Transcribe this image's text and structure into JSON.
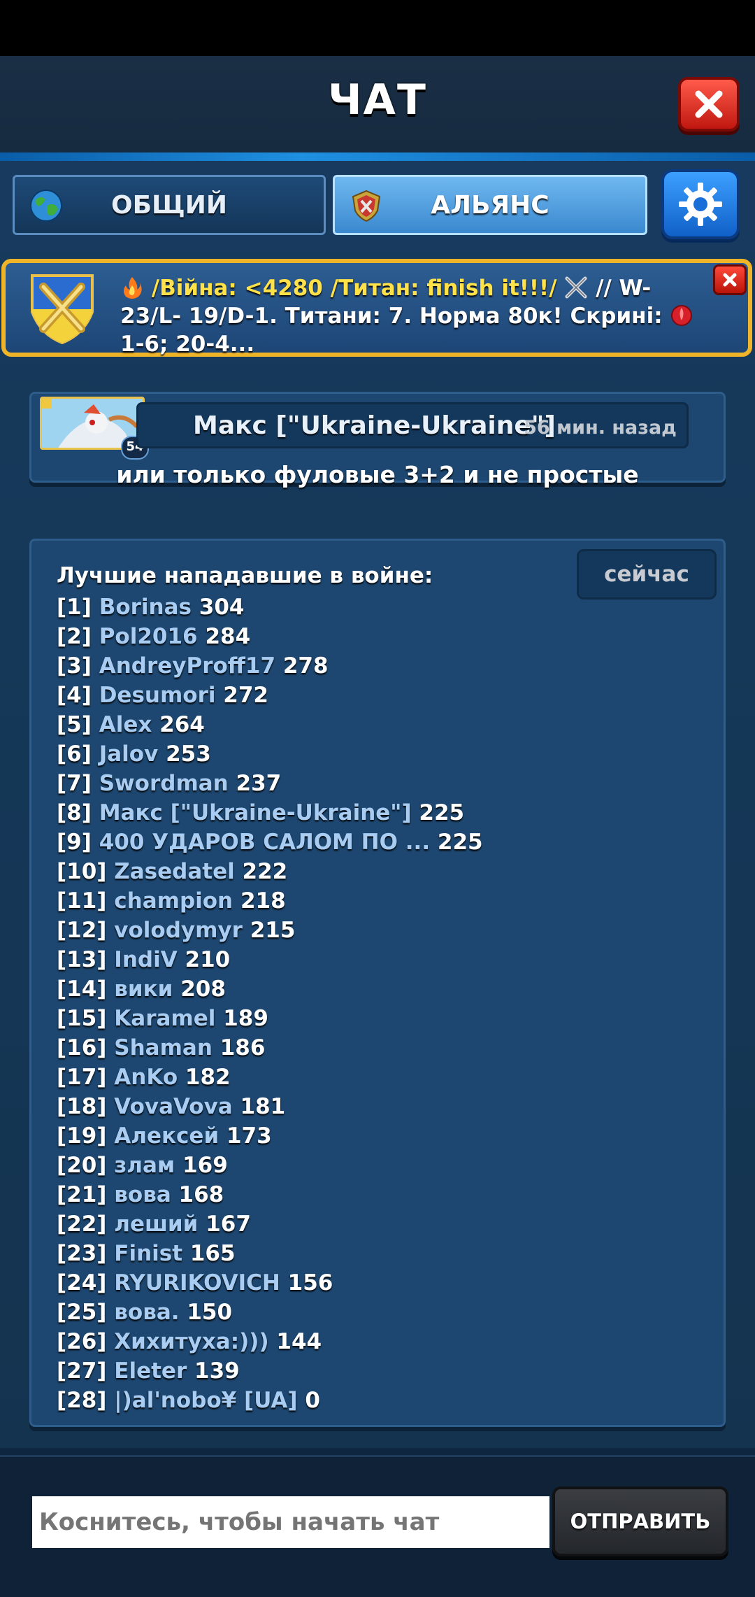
{
  "header": {
    "title": "ЧАТ"
  },
  "tabs": [
    {
      "label": "ОБЩИЙ",
      "icon": "globe-icon",
      "active": false
    },
    {
      "label": "АЛЬЯНС",
      "icon": "alliance-shield-icon",
      "active": true
    }
  ],
  "announcement": {
    "part1": "/Війна: <4280 /Титан: finish it!!!/",
    "part2": "// W-23/L-",
    "part3": "19/D-1. Титани: 7. Норма 80к! Скрині:",
    "part4": "1-6; 20-4...",
    "icons": [
      "fire-icon",
      "crossed-swords-icon",
      "red-gem-icon"
    ],
    "border_color": "#f0b429"
  },
  "message": {
    "author": "Макс [\"Ukraine-Ukraine\"]",
    "time": "56 мин. назад",
    "avatar_level": "54",
    "text": "или только фуловые 3+2 и не простые"
  },
  "system_message": {
    "time": "сейчас",
    "title": "Лучшие нападавшие в войне:",
    "entries": [
      {
        "rank": "[1]",
        "name": "Borinas",
        "score": "304"
      },
      {
        "rank": "[2]",
        "name": "Pol2016",
        "score": "284"
      },
      {
        "rank": "[3]",
        "name": "AndreyProff17",
        "score": "278"
      },
      {
        "rank": "[4]",
        "name": "Desumori",
        "score": "272"
      },
      {
        "rank": "[5]",
        "name": "Alex",
        "score": "264"
      },
      {
        "rank": "[6]",
        "name": "Jalov",
        "score": "253"
      },
      {
        "rank": "[7]",
        "name": "Swordman",
        "score": "237"
      },
      {
        "rank": "[8]",
        "name": "Макс [\"Ukraine-Ukraine\"]",
        "score": "225"
      },
      {
        "rank": "[9]",
        "name": "400 УДАРОВ САЛОМ ПО ...",
        "score": "225"
      },
      {
        "rank": "[10]",
        "name": "Zasedatel",
        "score": "222"
      },
      {
        "rank": "[11]",
        "name": "champion",
        "score": "218"
      },
      {
        "rank": "[12]",
        "name": "volodymyr",
        "score": "215"
      },
      {
        "rank": "[13]",
        "name": "IndiV",
        "score": "210"
      },
      {
        "rank": "[14]",
        "name": "вики",
        "score": "208"
      },
      {
        "rank": "[15]",
        "name": "Karamel",
        "score": "189"
      },
      {
        "rank": "[16]",
        "name": "Shaman",
        "score": "186"
      },
      {
        "rank": "[17]",
        "name": "AnKo",
        "score": "182"
      },
      {
        "rank": "[18]",
        "name": "VovaVova",
        "score": "181"
      },
      {
        "rank": "[19]",
        "name": "Алексей",
        "score": "173"
      },
      {
        "rank": "[20]",
        "name": "злам",
        "score": "169"
      },
      {
        "rank": "[21]",
        "name": "вова",
        "score": "168"
      },
      {
        "rank": "[22]",
        "name": "леший",
        "score": "167"
      },
      {
        "rank": "[23]",
        "name": "Finist",
        "score": "165"
      },
      {
        "rank": "[24]",
        "name": "RYURIKOVICH",
        "score": "156"
      },
      {
        "rank": "[25]",
        "name": "вова.",
        "score": "150"
      },
      {
        "rank": "[26]",
        "name": "Хихитуха:)))",
        "score": "144"
      },
      {
        "rank": "[27]",
        "name": "Eleter",
        "score": "139"
      },
      {
        "rank": "[28]",
        "name": "|)al'nobo¥ [UA]",
        "score": "0"
      }
    ]
  },
  "composer": {
    "placeholder": "Коснитесь, чтобы начать чат",
    "send_label": "ОТПРАВИТЬ"
  }
}
